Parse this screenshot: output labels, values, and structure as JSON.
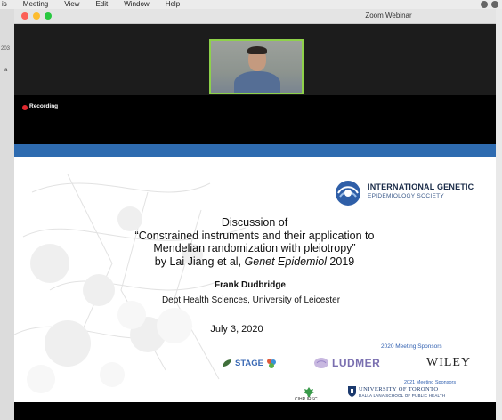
{
  "os_menubar": {
    "items": [
      "is",
      "Meeting",
      "View",
      "Edit",
      "Window",
      "Help"
    ]
  },
  "desktop_side": {
    "text1": "203",
    "text2": "a"
  },
  "window": {
    "title": "Zoom Webinar"
  },
  "recording": {
    "label": "Recording"
  },
  "slide": {
    "society_name": "INTERNATIONAL GENETIC",
    "society_sub": "EPIDEMIOLOGY SOCIETY",
    "title_line1": "Discussion of",
    "title_line2": "“Constrained instruments and their application to",
    "title_line3": "Mendelian randomization with pleiotropy”",
    "title_line4_pre": "by Lai Jiang et al, ",
    "title_line4_journal": "Genet Epidemiol",
    "title_line4_post": " 2019",
    "speaker": "Frank Dudbridge",
    "affiliation": "Dept Health Sciences, University of Leicester",
    "date": "July 3, 2020",
    "sponsors_2020_label": "2020 Meeting Sponsors",
    "sponsors_2020": [
      "STAGE",
      "LUDMER",
      "WILEY"
    ],
    "sponsors_2021_label": "2021 Meeting Sponsors",
    "sponsor_cihr": "CIHR IRSC",
    "sponsor_uoft_line1": "UNIVERSITY OF TORONTO",
    "sponsor_uoft_line2": "DALLA LANA SCHOOL OF PUBLIC HEALTH"
  },
  "colors": {
    "slide_band": "#2e6bb0",
    "recording_dot": "#e0282e",
    "active_speaker_border": "#8ed14a"
  }
}
